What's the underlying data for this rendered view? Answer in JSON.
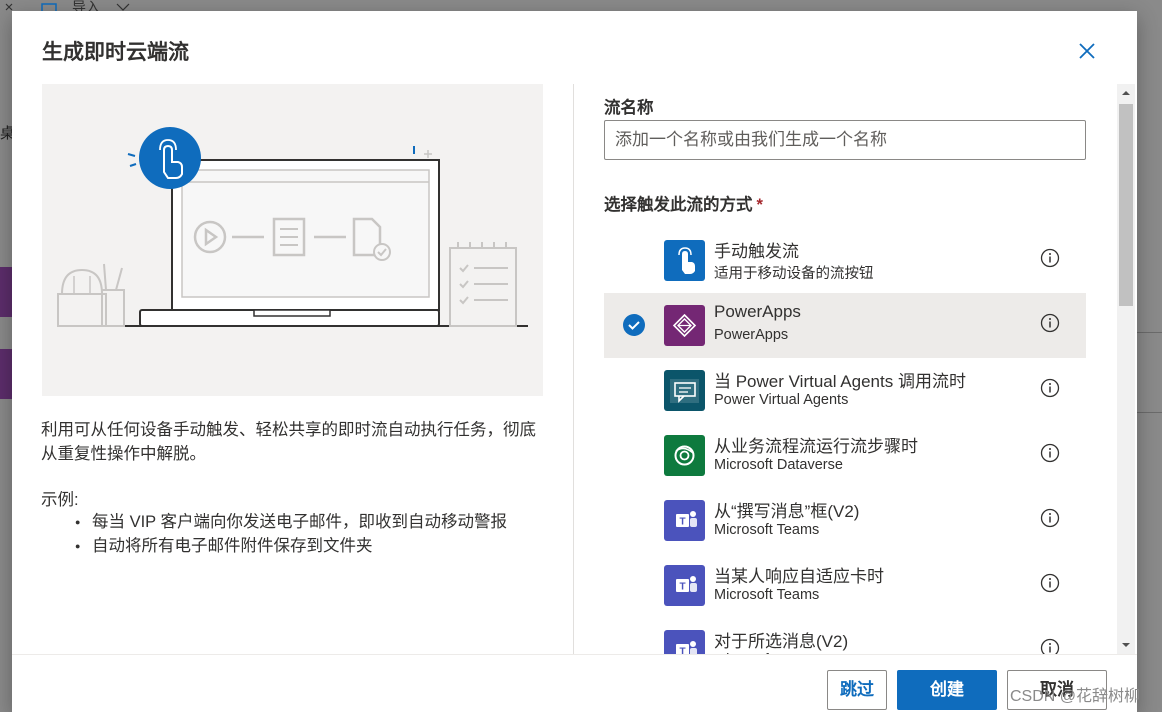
{
  "background": {
    "top_text": "导入",
    "left_char": "桌"
  },
  "dialog": {
    "title": "生成即时云端流",
    "description": "利用可从任何设备手动触发、轻松共享的即时流自动执行任务，彻底从重复性操作中解脱。",
    "examples_title": "示例:",
    "examples": [
      "每当 VIP 客户端向你发送电子邮件，即收到自动移动警报",
      "自动将所有电子邮件附件保存到文件夹"
    ]
  },
  "form": {
    "name_label": "流名称",
    "name_placeholder": "添加一个名称或由我们生成一个名称",
    "trigger_label": "选择触发此流的方式",
    "required_mark": "*"
  },
  "triggers": [
    {
      "title": "手动触发流",
      "subtitle": "适用于移动设备的流按钮",
      "icon": "touch-icon",
      "color": "#0f6cbd",
      "selected": false
    },
    {
      "title": "PowerApps",
      "subtitle": "PowerApps",
      "icon": "powerapps-icon",
      "color": "#742774",
      "selected": true
    },
    {
      "title": "当 Power Virtual Agents 调用流时",
      "subtitle": "Power Virtual Agents",
      "icon": "pva-chat-icon",
      "color": "#0b556a",
      "selected": false
    },
    {
      "title": "从业务流程流运行流步骤时",
      "subtitle": "Microsoft Dataverse",
      "icon": "dataverse-icon",
      "color": "#0e7a3e",
      "selected": false
    },
    {
      "title": "从“撰写消息”框(V2)",
      "subtitle": "Microsoft Teams",
      "icon": "teams-icon",
      "color": "#4b53bc",
      "selected": false
    },
    {
      "title": "当某人响应自适应卡时",
      "subtitle": "Microsoft Teams",
      "icon": "teams-icon",
      "color": "#4b53bc",
      "selected": false
    },
    {
      "title": "对于所选消息(V2)",
      "subtitle": "Microsoft Teams",
      "icon": "teams-icon",
      "color": "#4b53bc",
      "selected": false
    }
  ],
  "buttons": {
    "skip": "跳过",
    "create": "创建",
    "cancel": "取消"
  },
  "watermark": "CSDN @花辞树柳"
}
